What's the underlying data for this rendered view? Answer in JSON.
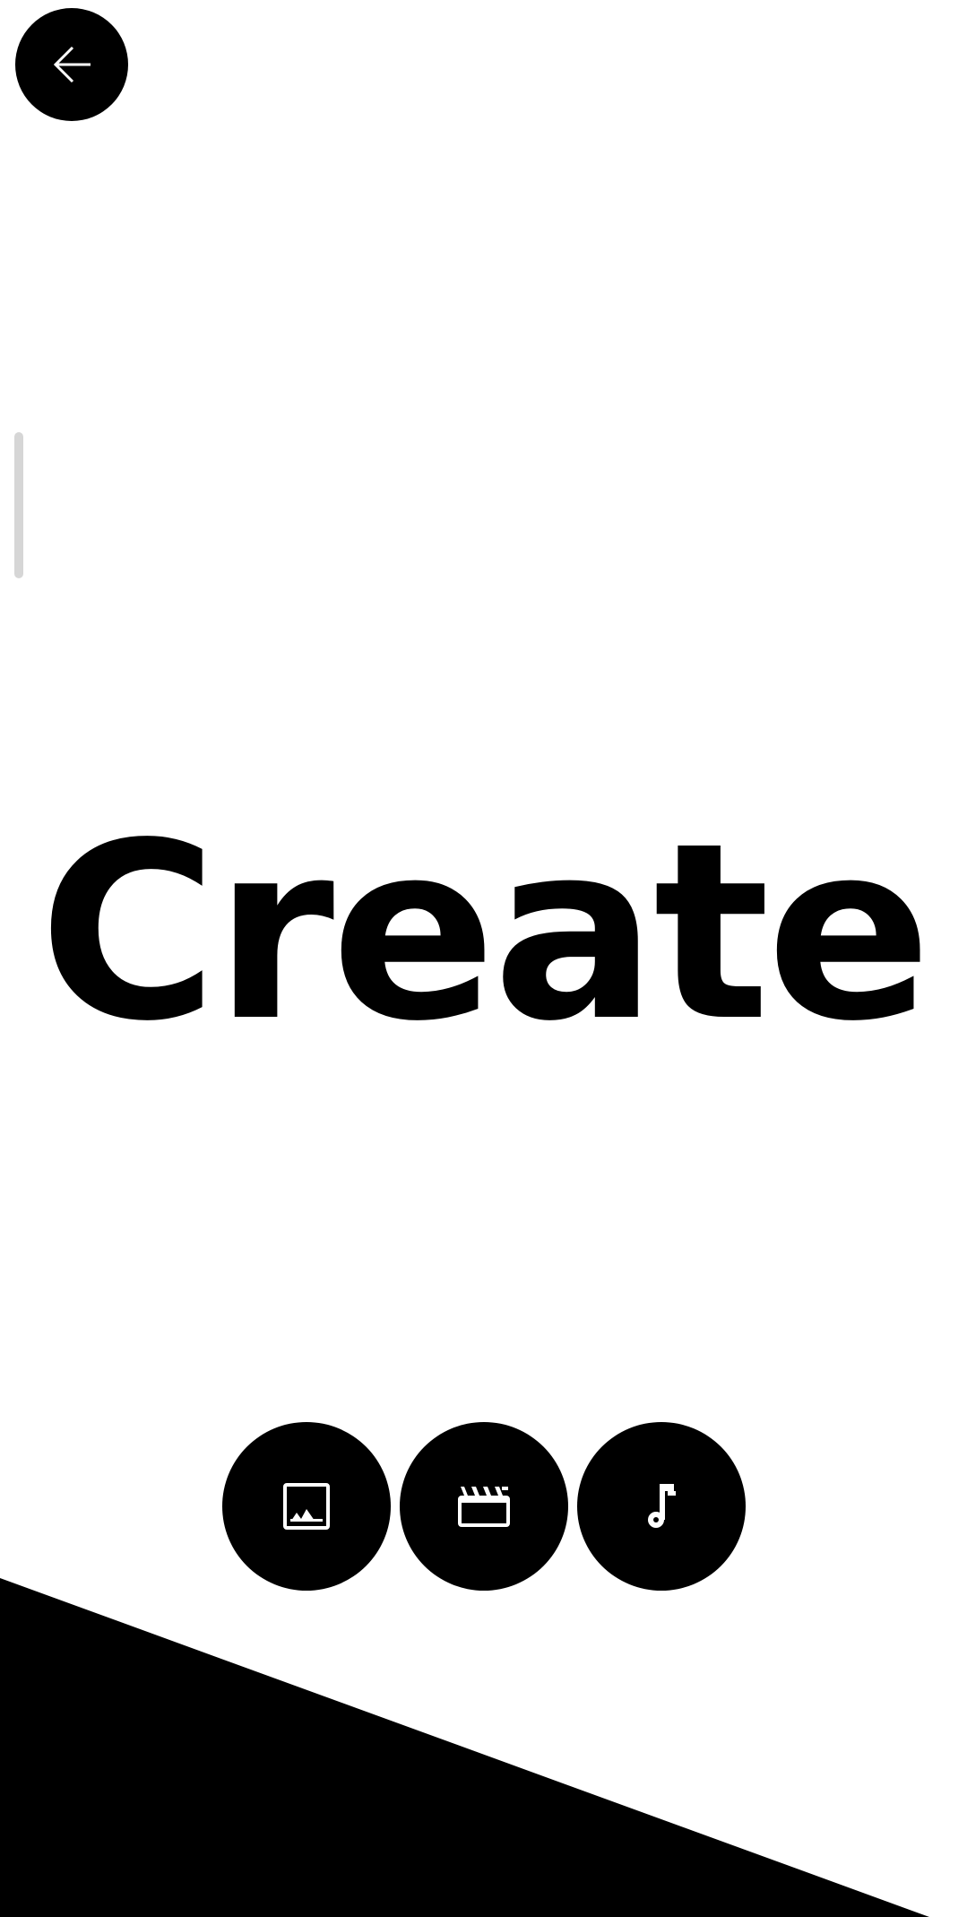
{
  "header": {
    "back_icon": "arrow-left-icon"
  },
  "main": {
    "title": "Create"
  },
  "media_options": [
    {
      "icon": "image-icon",
      "kind": "image"
    },
    {
      "icon": "clapperboard-icon",
      "kind": "video"
    },
    {
      "icon": "music-note-icon",
      "kind": "audio"
    }
  ],
  "colors": {
    "background": "#ffffff",
    "foreground": "#000000",
    "scroll_indicator": "#d6d6d6"
  }
}
